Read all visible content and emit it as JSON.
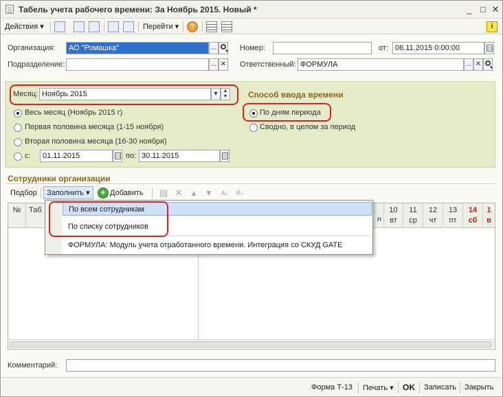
{
  "window": {
    "title": "Табель учета рабочего времени: За Ноябрь 2015. Новый *",
    "minimize": "_",
    "maximize": "□",
    "close": "✕"
  },
  "toolbar": {
    "actions": "Действия",
    "goto": "Перейти",
    "help": "?",
    "info": "i"
  },
  "form": {
    "org_label": "Организация:",
    "org_value": "АО \"Ромашка\"",
    "dept_label": "Подразделение:",
    "dept_value": "",
    "number_label": "Номер:",
    "number_value": "",
    "date_label": "от:",
    "date_value": "06.11.2015  0:00:00",
    "resp_label": "Ответственный:",
    "resp_value": "ФОРМУЛА",
    "dots": "...",
    "clear": "✕"
  },
  "period": {
    "month_label": "Месяц:",
    "month_value": "Ноябрь 2015",
    "options": [
      {
        "label": "Весь месяц (Ноябрь 2015 г)",
        "selected": true
      },
      {
        "label": "Первая половина месяца (1-15 ноября)",
        "selected": false
      },
      {
        "label": "Вторая половина месяца (16-30 ноября)",
        "selected": false
      },
      {
        "label": "с:",
        "selected": false
      }
    ],
    "from_value": "01.11.2015",
    "to_label": "по:",
    "to_value": "30.11.2015"
  },
  "input_method": {
    "title": "Способ ввода времени",
    "options": [
      {
        "label": "По дням периода",
        "selected": true
      },
      {
        "label": "Сводно, в целом за период",
        "selected": false
      }
    ]
  },
  "employees": {
    "title": "Сотрудники организации",
    "select": "Подбор",
    "fill": "Заполнить",
    "add": "Добавить",
    "columns": [
      {
        "num": "№",
        "day": ""
      },
      {
        "num": "Таб",
        "day": ""
      },
      {
        "num": "н",
        "day": ""
      },
      {
        "num": "10",
        "day": "вт"
      },
      {
        "num": "11",
        "day": "ср"
      },
      {
        "num": "12",
        "day": "чт"
      },
      {
        "num": "13",
        "day": "пт"
      },
      {
        "num": "14",
        "day": "сб"
      },
      {
        "num": "1",
        "day": "в"
      }
    ]
  },
  "fill_menu": {
    "items": [
      "По всем сотрудникам",
      "По списку сотрудников",
      "ФОРМУЛА: Модуль учета отработанного времени. Интеграция со СКУД GATE"
    ]
  },
  "comment": {
    "label": "Комментарий:",
    "value": ""
  },
  "footer": {
    "form_t13": "Форма Т-13",
    "print": "Печать",
    "ok": "OK",
    "save": "Записать",
    "close": "Закрыть"
  }
}
